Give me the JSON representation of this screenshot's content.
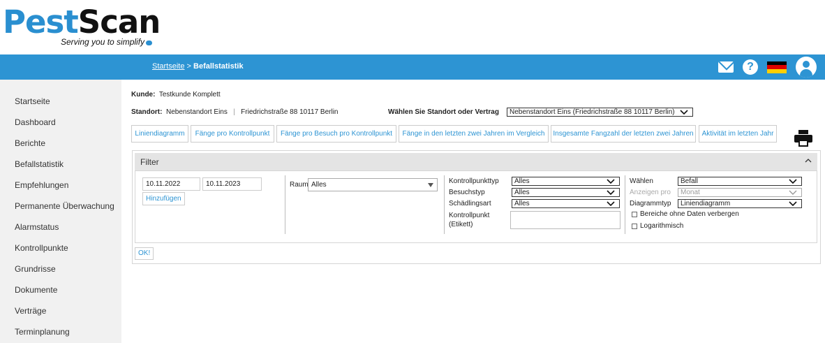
{
  "logo": {
    "part1": "Pest",
    "part2": "Scan",
    "tagline": "Serving you to simplify"
  },
  "breadcrumb": {
    "home": "Startseite",
    "separator": ">",
    "current": "Befallstatistik"
  },
  "top_icons": [
    "mail-icon",
    "help-icon",
    "flag-de-icon",
    "user-avatar-icon"
  ],
  "sidebar": {
    "items": [
      "Startseite",
      "Dashboard",
      "Berichte",
      "Befallstatistik",
      "Empfehlungen",
      "Permanente Überwachung",
      "Alarmstatus",
      "Kontrollpunkte",
      "Grundrisse",
      "Dokumente",
      "Verträge",
      "Terminplanung"
    ]
  },
  "info": {
    "kunde_label": "Kunde:",
    "kunde_value": "Testkunde Komplett",
    "standort_label": "Standort:",
    "standort_value": "Nebenstandort Eins",
    "standort_sep": "|",
    "standort_address": "Friedrichstraße 88 10117 Berlin",
    "choose_label": "Wählen Sie Standort oder Vertrag",
    "choose_value": "Nebenstandort Eins (Friedrichstraße 88 10117 Berlin)"
  },
  "tabs": [
    "Liniendiagramm",
    "Fänge pro Kontrollpunkt",
    "Fänge pro Besuch pro Kontrollpunkt",
    "Fänge in den letzten zwei Jahren im Vergleich",
    "Insgesamte Fangzahl der letzten zwei Jahren",
    "Aktivität im letzten Jahr"
  ],
  "filter": {
    "title": "Filter",
    "date_from": "10.11.2022",
    "date_to": "10.11.2023",
    "add_label": "Hinzufügen",
    "raum_label": "Raum",
    "raum_value": "Alles",
    "kontrollpunkttyp_label": "Kontrollpunkttyp",
    "kontrollpunkttyp_value": "Alles",
    "besuchstyp_label": "Besuchstyp",
    "besuchstyp_value": "Alles",
    "schaedlingsart_label": "Schädlingsart",
    "schaedlingsart_value": "Alles",
    "kontrollpunkt_label_1": "Kontrollpunkt",
    "kontrollpunkt_label_2": "(Etikett)",
    "kontrollpunkt_value": "",
    "waehlen_label": "Wählen",
    "waehlen_value": "Befall",
    "anzeigen_label": "Anzeigen pro",
    "anzeigen_value": "Monat",
    "diagrammtyp_label": "Diagrammtyp",
    "diagrammtyp_value": "Liniendiagramm",
    "cb_bereiche": "Bereiche ohne Daten verbergen",
    "cb_log": "Logarithmisch",
    "ok_label": "OK!"
  },
  "colors": {
    "brand_blue": "#2d94d3",
    "sidebar_bg": "#f1f1f1",
    "filter_head_bg": "#e4e4e4"
  }
}
